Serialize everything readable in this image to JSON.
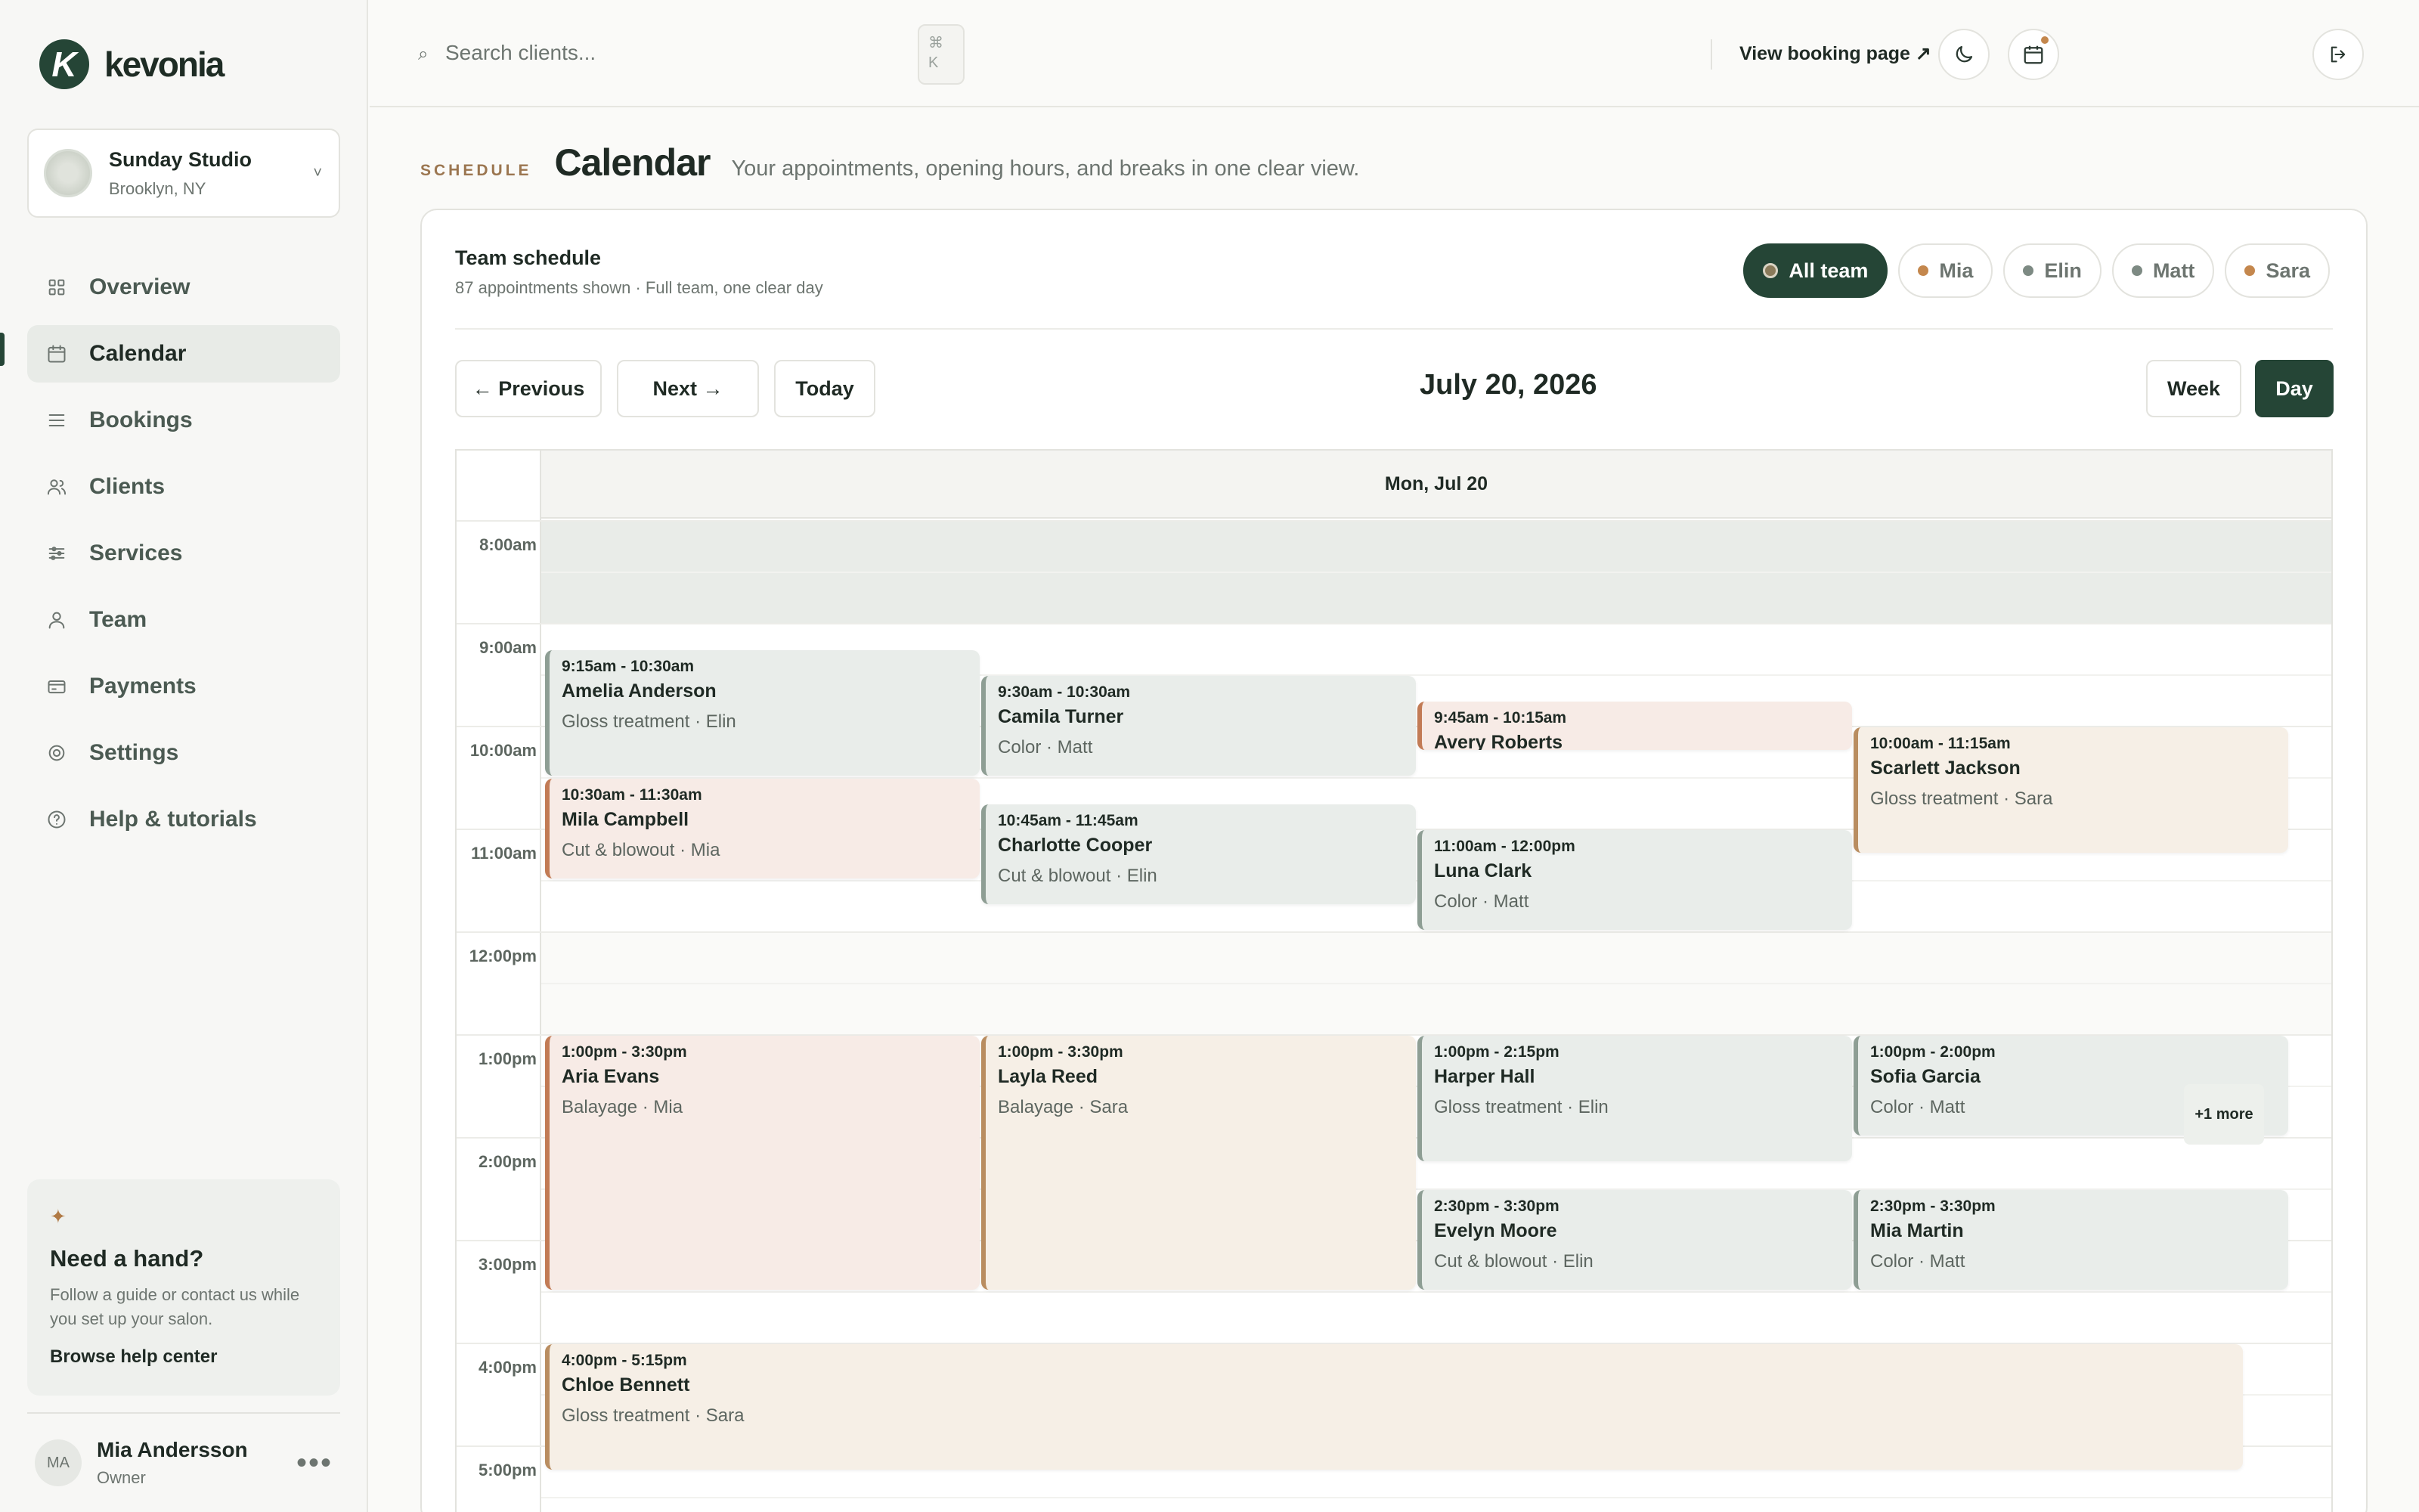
{
  "brand": {
    "logo_letter": "K",
    "name": "kevonia"
  },
  "studio": {
    "name": "Sunday Studio",
    "location": "Brooklyn, NY",
    "avatar_text": "Sunday"
  },
  "nav": {
    "items": [
      {
        "label": "Overview",
        "icon": "grid-icon"
      },
      {
        "label": "Calendar",
        "icon": "calendar-icon",
        "active": true
      },
      {
        "label": "Bookings",
        "icon": "list-icon"
      },
      {
        "label": "Clients",
        "icon": "users-icon"
      },
      {
        "label": "Services",
        "icon": "sliders-icon"
      },
      {
        "label": "Team",
        "icon": "person-icon"
      },
      {
        "label": "Payments",
        "icon": "card-icon"
      },
      {
        "label": "Settings",
        "icon": "gear-icon"
      },
      {
        "label": "Help & tutorials",
        "icon": "help-icon"
      }
    ]
  },
  "help": {
    "star": "✦",
    "title": "Need a hand?",
    "text": "Follow a guide or contact us while you set up your salon.",
    "link": "Browse help center"
  },
  "user": {
    "initials": "MA",
    "name": "Mia Andersson",
    "role": "Owner",
    "menu": "•••"
  },
  "topbar": {
    "search_placeholder": "Search clients...",
    "search_icon": "⌕",
    "shortcut_line1": "⌘",
    "shortcut_line2": "K",
    "booking_link": "View booking page ↗"
  },
  "header": {
    "eyebrow": "SCHEDULE",
    "title": "Calendar",
    "subtitle": "Your appointments, opening hours, and breaks in one clear view."
  },
  "panel": {
    "title": "Team schedule",
    "subtitle": "87 appointments shown · Full team, one clear day"
  },
  "filters": [
    {
      "label": "All team",
      "color": "#8a7a5a",
      "active": true
    },
    {
      "label": "Mia",
      "color": "#c4874d"
    },
    {
      "label": "Elin",
      "color": "#7d8a83"
    },
    {
      "label": "Matt",
      "color": "#7d8a83"
    },
    {
      "label": "Sara",
      "color": "#c4874d"
    }
  ],
  "nav_buttons": {
    "previous": "← Previous",
    "next": "Next →",
    "today": "Today"
  },
  "date_title": "July 20, 2026",
  "views": {
    "week": "Week",
    "day": "Day",
    "active": "Day"
  },
  "column_header": "Mon, Jul 20",
  "times": [
    "8:00am",
    "9:00am",
    "10:00am",
    "11:00am",
    "12:00pm",
    "1:00pm",
    "2:00pm",
    "3:00pm",
    "4:00pm",
    "5:00pm"
  ],
  "colors": {
    "accent": "#254536",
    "mia": "#c27b55",
    "sara": "#b98d60",
    "elin_matt": "#8e9e94"
  },
  "appointments": [
    {
      "time": "9:15am - 10:30am",
      "name": "Amelia Anderson",
      "meta": "Gloss treatment · Elin",
      "style": "green",
      "start": 9.25,
      "end": 10.5,
      "col": 0,
      "span": 1
    },
    {
      "time": "9:30am - 10:30am",
      "name": "Camila Turner",
      "meta": "Color · Matt",
      "style": "green",
      "start": 9.5,
      "end": 10.5,
      "col": 1,
      "span": 1
    },
    {
      "time": "9:45am - 10:15am",
      "name": "Avery Roberts",
      "meta": "",
      "style": "pink",
      "start": 9.75,
      "end": 10.25,
      "col": 2,
      "span": 1
    },
    {
      "time": "10:00am - 11:15am",
      "name": "Scarlett Jackson",
      "meta": "Gloss treatment · Sara",
      "style": "sand",
      "start": 10,
      "end": 11.25,
      "col": 3,
      "span": 1
    },
    {
      "time": "10:30am - 11:30am",
      "name": "Mila Campbell",
      "meta": "Cut & blowout · Mia",
      "style": "pink",
      "start": 10.5,
      "end": 11.5,
      "col": 0,
      "span": 1
    },
    {
      "time": "10:45am - 11:45am",
      "name": "Charlotte Cooper",
      "meta": "Cut & blowout · Elin",
      "style": "green",
      "start": 10.75,
      "end": 11.75,
      "col": 1,
      "span": 1
    },
    {
      "time": "11:00am - 12:00pm",
      "name": "Luna Clark",
      "meta": "Color · Matt",
      "style": "green",
      "start": 11,
      "end": 12,
      "col": 2,
      "span": 1
    },
    {
      "time": "1:00pm - 3:30pm",
      "name": "Aria Evans",
      "meta": "Balayage · Mia",
      "style": "pink",
      "start": 13,
      "end": 15.5,
      "col": 0,
      "span": 1
    },
    {
      "time": "1:00pm - 3:30pm",
      "name": "Layla Reed",
      "meta": "Balayage · Sara",
      "style": "sand",
      "start": 13,
      "end": 15.5,
      "col": 1,
      "span": 1
    },
    {
      "time": "1:00pm - 2:15pm",
      "name": "Harper Hall",
      "meta": "Gloss treatment · Elin",
      "style": "green",
      "start": 13,
      "end": 14.25,
      "col": 2,
      "span": 1
    },
    {
      "time": "1:00pm - 2:00pm",
      "name": "Sofia Garcia",
      "meta": "Color · Matt",
      "style": "green",
      "start": 13,
      "end": 14,
      "col": 3,
      "span": 1
    },
    {
      "time": "2:30pm - 3:30pm",
      "name": "Evelyn Moore",
      "meta": "Cut & blowout · Elin",
      "style": "green",
      "start": 14.5,
      "end": 15.5,
      "col": 2,
      "span": 1
    },
    {
      "time": "2:30pm - 3:30pm",
      "name": "Mia Martin",
      "meta": "Color · Matt",
      "style": "green",
      "start": 14.5,
      "end": 15.5,
      "col": 3,
      "span": 1
    },
    {
      "time": "4:00pm - 5:15pm",
      "name": "Chloe Bennett",
      "meta": "Gloss treatment · Sara",
      "style": "sand",
      "start": 16,
      "end": 17.25,
      "col": 0,
      "span": 4
    }
  ],
  "more_label": "+1 more"
}
